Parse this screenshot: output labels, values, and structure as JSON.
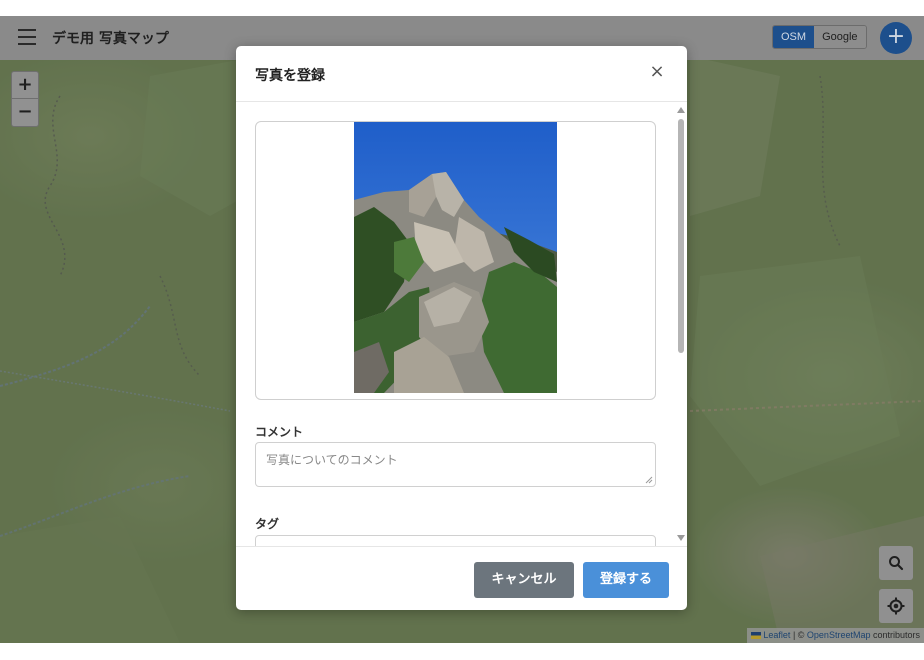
{
  "header": {
    "title": "デモ用 写真マップ",
    "layers": [
      {
        "label": "OSM",
        "active": true
      },
      {
        "label": "Google",
        "active": false
      }
    ],
    "add_label": "+"
  },
  "map": {
    "zoom_in": "+",
    "zoom_out": "−",
    "attribution": {
      "leaflet": "Leaflet",
      "separator": " | © ",
      "osm": "OpenStreetMap",
      "suffix": " contributors"
    }
  },
  "modal": {
    "title": "写真を登録",
    "close": "×",
    "comment_label": "コメント",
    "comment_placeholder": "写真についてのコメント",
    "tag_label": "タグ",
    "cancel": "キャンセル",
    "submit": "登録する"
  },
  "colors": {
    "primary": "#4a90d9",
    "secondary": "#6c757d",
    "header_active": "#1d4f8c"
  }
}
